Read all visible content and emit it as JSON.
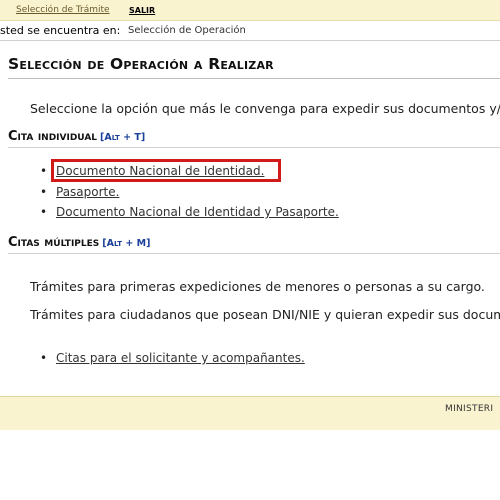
{
  "topnav": {
    "seleccion_tramite": "Selección de Trámite",
    "salir": "SALIR"
  },
  "location": {
    "label": "Usted se encuentra en:",
    "value": "Selección de Operación"
  },
  "title": "Selección de Operación a Realizar",
  "intro": "Seleccione la opción que más le convenga para expedir sus documentos y/",
  "section_individual": {
    "heading": "Cita individual",
    "shortcut": "[Alt + T]",
    "options": [
      "Documento Nacional de Identidad.",
      "Pasaporte.",
      "Documento Nacional de Identidad y Pasaporte."
    ]
  },
  "section_multiple": {
    "heading": "Citas múltiples",
    "shortcut": "[Alt + M]",
    "para1": "Trámites para primeras expediciones de menores o personas a su cargo.",
    "para2": "Trámites para ciudadanos que posean DNI/NIE y quieran expedir sus docum",
    "options": [
      "Citas para el solicitante y acompañantes."
    ]
  },
  "footer": {
    "text": "MINISTERI"
  },
  "colors": {
    "nav_background": "#faf3d0",
    "highlight_border": "#d11a1a",
    "shortcut_text": "#1a3f9a"
  }
}
